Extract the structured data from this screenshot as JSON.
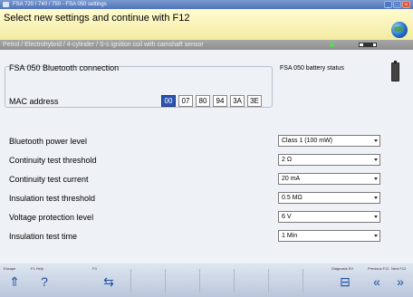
{
  "window": {
    "title": "FSA 720 / 740 / 750 - FSA 050 settings",
    "buttons": {
      "minimize": "_",
      "maximize": "□",
      "close": "×"
    }
  },
  "header": {
    "instruction": "Select new settings and continue with F12",
    "icon": "globe-icon"
  },
  "statusbar": {
    "vehicle": "Petrol / Electrohybrid / 4-cylinder / S-s ignition coil with camshaft sensor",
    "led_color": "#4ee24e"
  },
  "bluetooth": {
    "group_title": "FSA 050 Bluetooth connection",
    "mac_label": "MAC address",
    "mac": [
      "00",
      "07",
      "80",
      "94",
      "3A",
      "3E"
    ]
  },
  "battery": {
    "label": "FSA 050 battery status"
  },
  "settings": [
    {
      "label": "Bluetooth power level",
      "value": "Class 1 (100 mW)"
    },
    {
      "label": "Continuity test threshold",
      "value": "2 Ω"
    },
    {
      "label": "Continuity test current",
      "value": "20 mA"
    },
    {
      "label": "Insulation test threshold",
      "value": "0.5 MΩ"
    },
    {
      "label": "Voltage protection level",
      "value": "6 V"
    },
    {
      "label": "Insulation test time",
      "value": "1 Min"
    }
  ],
  "footer": {
    "escape": {
      "caption": "Escape",
      "icon": "double-up-arrow-icon"
    },
    "f1": {
      "caption": "F1     Help",
      "icon": "help-icon"
    },
    "f3": {
      "caption": "F3",
      "icon": "bluetooth-connect-icon"
    },
    "f10": {
      "caption": "Diagnosis  SV",
      "icon": "diagnosis-icon"
    },
    "f11": {
      "caption": "Previous  F11",
      "icon": "previous-icon"
    },
    "f12": {
      "caption": "Next  F12",
      "icon": "next-icon"
    }
  }
}
